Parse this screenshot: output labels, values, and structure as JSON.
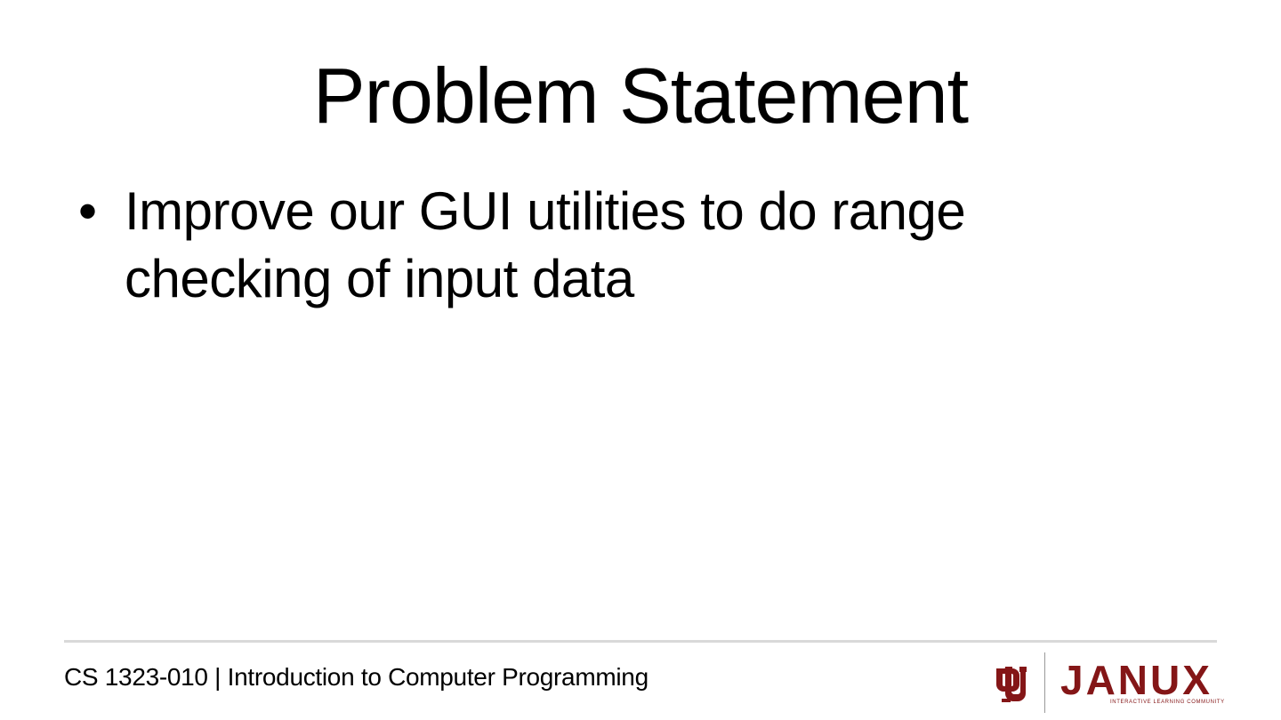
{
  "slide": {
    "title": "Problem Statement",
    "bullets": [
      {
        "marker": "•",
        "text": "Improve our GUI utilities to do range checking of input data"
      }
    ]
  },
  "footer": {
    "course_text": "CS 1323-010 | Introduction to Computer Programming"
  },
  "branding": {
    "ou_logo_icon": "ou-interlocking-logo",
    "janux_text": "JANUX",
    "janux_tagline": "INTERACTIVE LEARNING COMMUNITY",
    "brand_color": "#841617"
  },
  "colors": {
    "background": "#ffffff",
    "text": "#000000",
    "rule": "#d9d9d9"
  }
}
